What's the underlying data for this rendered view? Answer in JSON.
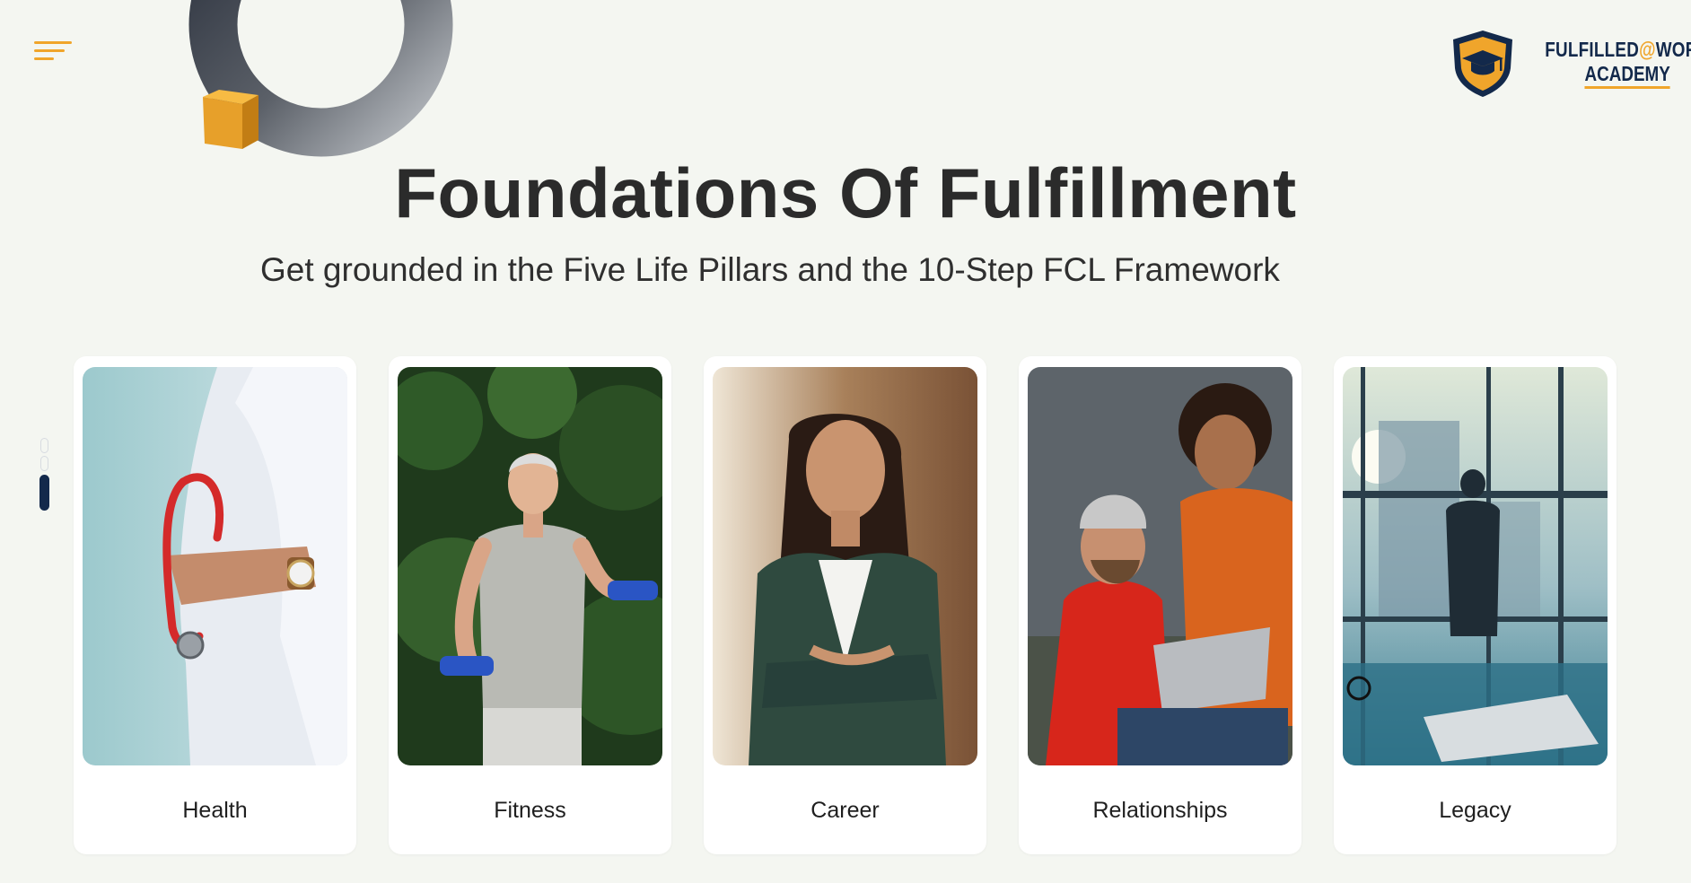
{
  "header": {
    "title": "Foundations Of Fulfillment",
    "subtitle": "Get grounded in the Five Life Pillars and the 10-Step FCL Framework"
  },
  "logo": {
    "line1_prefix": "FULFILLED",
    "line1_at": "@",
    "line1_suffix": "WORK",
    "line2": "ACADEMY",
    "icon": "graduation-cap-shield-icon"
  },
  "menu": {
    "icon": "hamburger-menu-icon"
  },
  "colors": {
    "accent": "#f0a52b",
    "navy": "#13294b",
    "background": "#f4f6f1"
  },
  "pillars": [
    {
      "label": "Health"
    },
    {
      "label": "Fitness"
    },
    {
      "label": "Career"
    },
    {
      "label": "Relationships"
    },
    {
      "label": "Legacy"
    }
  ],
  "pager": {
    "count": 3,
    "active": 3
  }
}
